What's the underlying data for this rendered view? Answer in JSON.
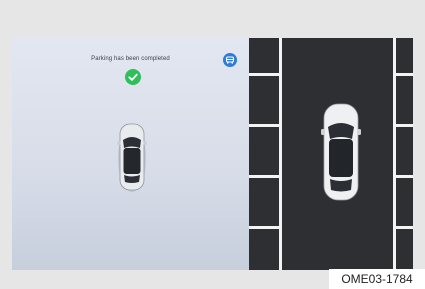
{
  "screen": {
    "status_message": "Parking has been completed",
    "status_icon": "check-circle-icon",
    "view_button_icon": "car-view-icon",
    "accent_color": "#2f7bd6",
    "success_color": "#2fbf5a"
  },
  "figure_code": "OME03-1784"
}
